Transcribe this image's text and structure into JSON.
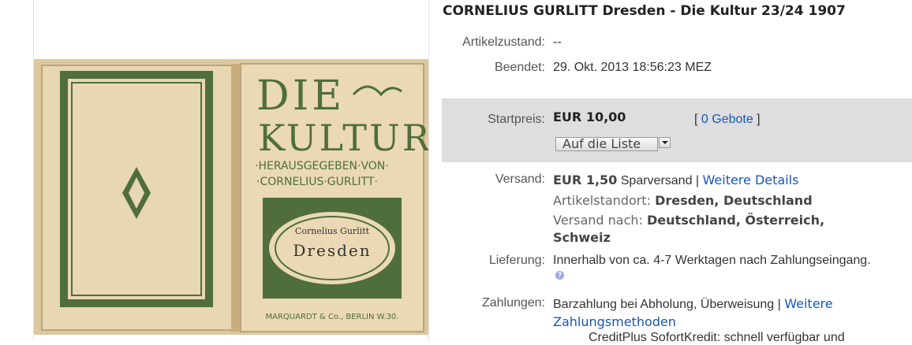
{
  "listing": {
    "title": "CORNELIUS GURLITT Dresden - Die Kultur 23/24 1907",
    "condition": {
      "label": "Artikelzustand:",
      "value": "--"
    },
    "ended": {
      "label": "Beendet:",
      "value": "29. Okt. 2013  18:56:23 MEZ"
    },
    "price": {
      "label": "Startpreis:",
      "value": "EUR 10,00",
      "bids_open": "[ ",
      "bids_link": "0 Gebote",
      "bids_close": " ]",
      "watch_button": "Auf die Liste"
    },
    "shipping": {
      "label": "Versand:",
      "cost": "EUR 1,50",
      "method": " Sparversand | ",
      "details_link": "Weitere Details",
      "location_label": "Artikelstandort: ",
      "location_value": "Dresden, Deutschland",
      "ships_to_label": "Versand nach: ",
      "ships_to_value_1": "Deutschland, Österreich,",
      "ships_to_value_2": "Schweiz"
    },
    "delivery": {
      "label": "Lieferung:",
      "value": "Innerhalb von ca. 4-7 Werktagen nach Zahlungseingang."
    },
    "payments": {
      "label": "Zahlungen:",
      "value": "Barzahlung bei Abholung,  Überweisung  | ",
      "more_link_1": "Weitere",
      "more_link_2": "Zahlungsmethoden",
      "credit": "CreditPlus SofortKredit: schnell verfügbar und"
    }
  },
  "book_image": {
    "line1": "DIE",
    "line2": "KULTUR",
    "editor_1": "·HERAUSGEGEBEN·VON·",
    "editor_2": "·CORNELIUS·GURLITT·",
    "author": "Cornelius Gurlitt",
    "city": "Dresden",
    "publisher": "MARQUARDT & Co., BERLIN W.30.",
    "colors": {
      "paper": "#e9d7b0",
      "ink": "#4f6e3b",
      "shadow": "#b89a6c"
    }
  }
}
